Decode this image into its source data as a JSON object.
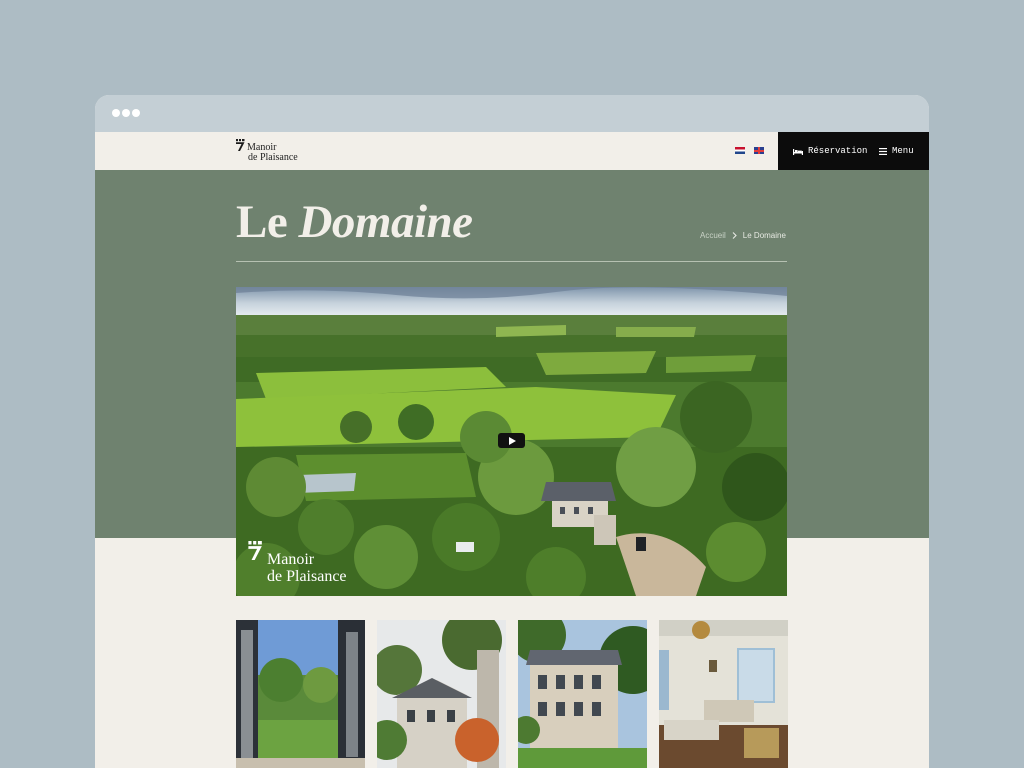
{
  "brand": {
    "line1": "Manoir",
    "line2": "de Plaisance"
  },
  "languages": [
    {
      "code": "nl",
      "icon": "flag-nl-icon"
    },
    {
      "code": "en",
      "icon": "flag-uk-icon"
    }
  ],
  "nav": {
    "reservation_label": "Réservation",
    "menu_label": "Menu"
  },
  "page": {
    "title_plain": "Le",
    "title_italic": "Domaine"
  },
  "breadcrumb": {
    "home": "Accueil",
    "current": "Le Domaine"
  },
  "video": {
    "overlay_line1": "Manoir",
    "overlay_line2": "de Plaisance"
  },
  "colors": {
    "hero_bg": "#6f826f",
    "page_bg": "#f2efe9",
    "nav_bg": "#0c0c0c",
    "outer_bg": "#adbcc4"
  }
}
